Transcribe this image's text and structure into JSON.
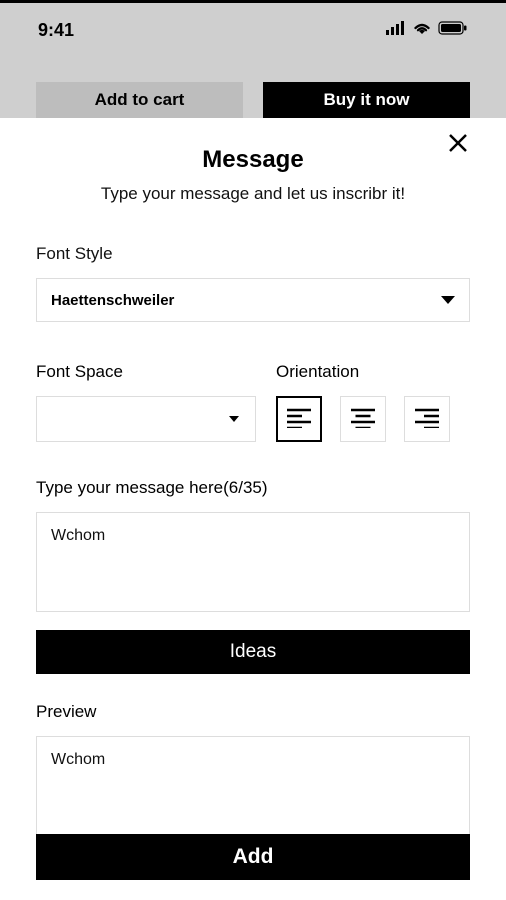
{
  "status_bar": {
    "time": "9:41"
  },
  "header_buttons": {
    "add_to_cart": "Add to cart",
    "buy_now": "Buy it now"
  },
  "modal": {
    "title": "Message",
    "subtitle": "Type your message and let us inscribr it!",
    "font_style_label": "Font Style",
    "font_style_value": "Haettenschweiler",
    "font_space_label": "Font Space",
    "font_space_value": "",
    "orientation_label": "Orientation",
    "message_label": "Type your message here(6/35)",
    "message_value": "Wchom",
    "ideas_button": "Ideas",
    "preview_label": "Preview",
    "preview_value": "Wchom",
    "add_button": "Add"
  }
}
